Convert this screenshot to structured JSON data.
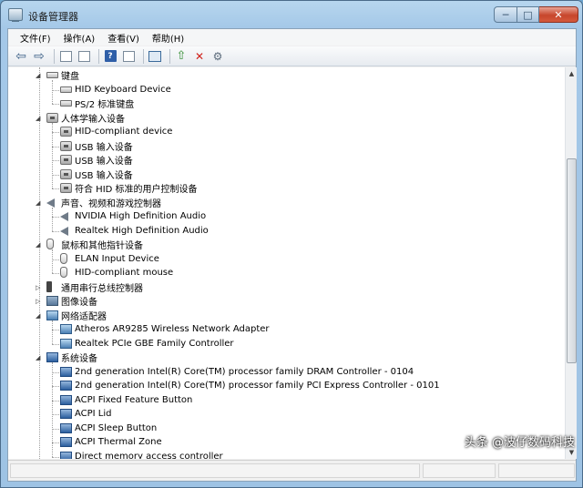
{
  "window": {
    "title": "设备管理器"
  },
  "caption": {
    "min": "─",
    "max": "□",
    "close": "✕"
  },
  "menu": [
    "文件(F)",
    "操作(A)",
    "查看(V)",
    "帮助(H)"
  ],
  "tree": [
    {
      "label": "键盘",
      "level": 0,
      "icon": "keyboard-icon",
      "expanded": true
    },
    {
      "label": "HID Keyboard Device",
      "level": 1,
      "icon": "keyboard-icon"
    },
    {
      "label": "PS/2 标准键盘",
      "level": 1,
      "icon": "keyboard-icon"
    },
    {
      "label": "人体学输入设备",
      "level": 0,
      "icon": "hid-icon",
      "expanded": true
    },
    {
      "label": "HID-compliant device",
      "level": 1,
      "icon": "hid-icon"
    },
    {
      "label": "USB 输入设备",
      "level": 1,
      "icon": "hid-icon"
    },
    {
      "label": "USB 输入设备",
      "level": 1,
      "icon": "hid-icon"
    },
    {
      "label": "USB 输入设备",
      "level": 1,
      "icon": "hid-icon"
    },
    {
      "label": "符合 HID 标准的用户控制设备",
      "level": 1,
      "icon": "hid-icon"
    },
    {
      "label": "声音、视频和游戏控制器",
      "level": 0,
      "icon": "speaker-icon",
      "expanded": true
    },
    {
      "label": "NVIDIA High Definition Audio",
      "level": 1,
      "icon": "speaker-icon"
    },
    {
      "label": "Realtek High Definition Audio",
      "level": 1,
      "icon": "speaker-icon"
    },
    {
      "label": "鼠标和其他指针设备",
      "level": 0,
      "icon": "mouse-icon",
      "expanded": true
    },
    {
      "label": "ELAN Input Device",
      "level": 1,
      "icon": "mouse-icon"
    },
    {
      "label": "HID-compliant mouse",
      "level": 1,
      "icon": "mouse-icon"
    },
    {
      "label": "通用串行总线控制器",
      "level": 0,
      "icon": "usb-icon",
      "expanded": false
    },
    {
      "label": "图像设备",
      "level": 0,
      "icon": "camera-icon",
      "expanded": false
    },
    {
      "label": "网络适配器",
      "level": 0,
      "icon": "network-icon",
      "expanded": true
    },
    {
      "label": "Atheros AR9285 Wireless Network Adapter",
      "level": 1,
      "icon": "network-icon"
    },
    {
      "label": "Realtek PCIe GBE Family Controller",
      "level": 1,
      "icon": "network-icon"
    },
    {
      "label": "系统设备",
      "level": 0,
      "icon": "system-icon",
      "expanded": true
    },
    {
      "label": "2nd generation Intel(R) Core(TM) processor family DRAM Controller - 0104",
      "level": 1,
      "icon": "system-icon"
    },
    {
      "label": "2nd generation Intel(R) Core(TM) processor family PCI Express Controller - 0101",
      "level": 1,
      "icon": "system-icon"
    },
    {
      "label": "ACPI Fixed Feature Button",
      "level": 1,
      "icon": "system-icon"
    },
    {
      "label": "ACPI Lid",
      "level": 1,
      "icon": "system-icon"
    },
    {
      "label": "ACPI Sleep Button",
      "level": 1,
      "icon": "system-icon"
    },
    {
      "label": "ACPI Thermal Zone",
      "level": 1,
      "icon": "system-icon"
    },
    {
      "label": "Direct memory access controller",
      "level": 1,
      "icon": "system-icon"
    }
  ],
  "watermark": "头条 @波仔数码科技"
}
